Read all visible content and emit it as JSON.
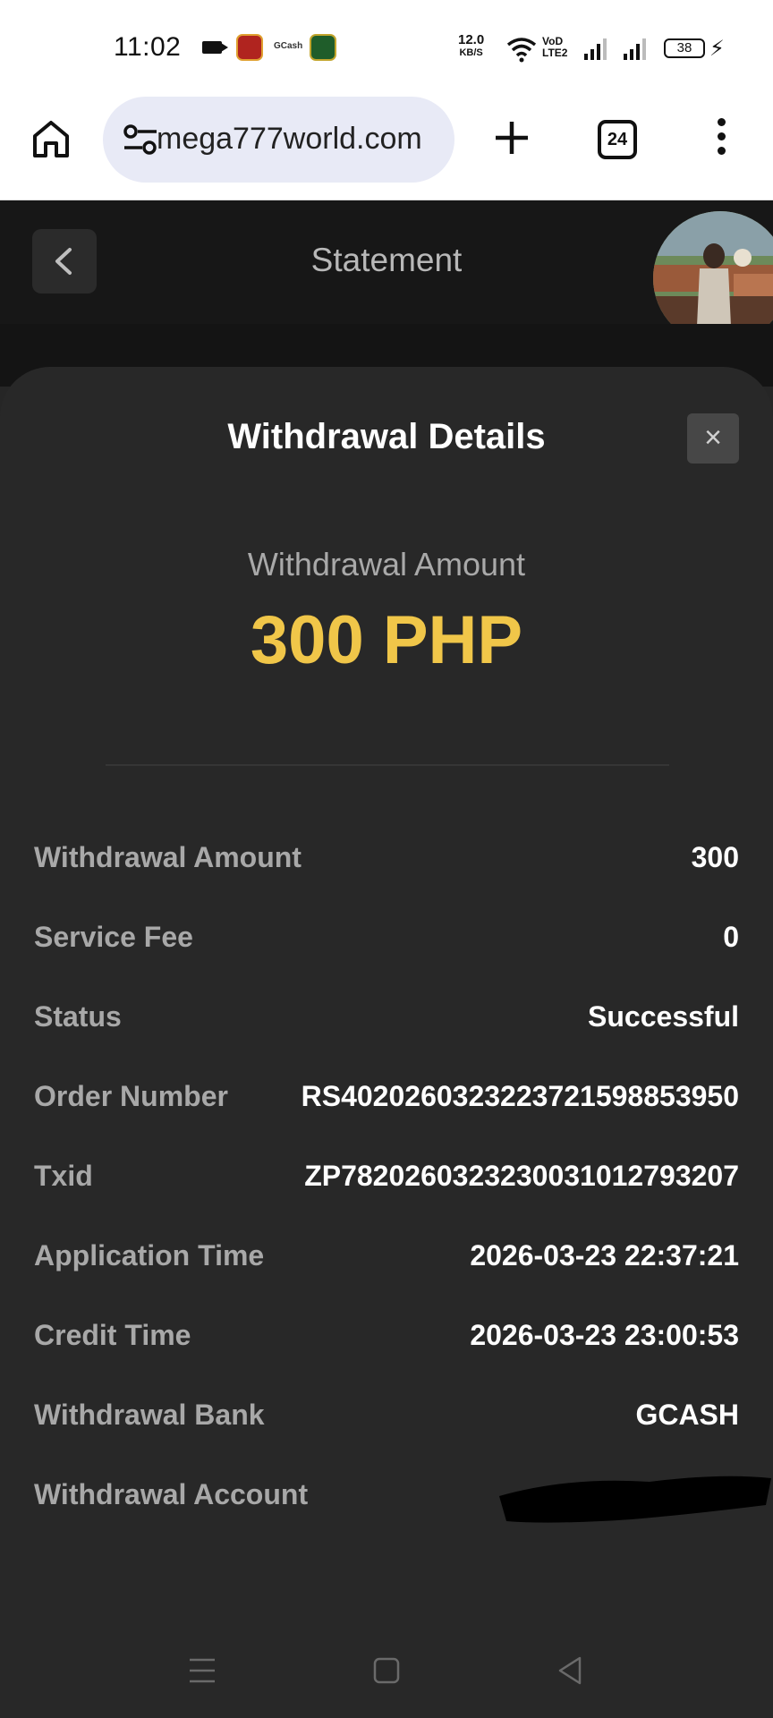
{
  "status_bar": {
    "time": "11:02",
    "gcash_label": "GCash",
    "net_speed_value": "12.0",
    "net_speed_unit": "KB/S",
    "volte_line1": "VoD",
    "volte_line2": "LTE2",
    "battery": "38"
  },
  "browser": {
    "url": "mega777world.com",
    "tab_count": "24"
  },
  "header": {
    "title": "Statement"
  },
  "sheet": {
    "title": "Withdrawal Details",
    "close": "×",
    "amount_label": "Withdrawal Amount",
    "amount_value": "300 PHP",
    "rows": [
      {
        "label": "Withdrawal Amount",
        "value": "300"
      },
      {
        "label": "Service Fee",
        "value": "0"
      },
      {
        "label": "Status",
        "value": "Successful"
      },
      {
        "label": "Order Number",
        "value": "RS4020260323223721598853950"
      },
      {
        "label": "Txid",
        "value": "ZP7820260323230031012793207"
      },
      {
        "label": "Application Time",
        "value": "2026-03-23 22:37:21"
      },
      {
        "label": "Credit Time",
        "value": "2026-03-23 23:00:53"
      },
      {
        "label": "Withdrawal Bank",
        "value": "GCASH"
      },
      {
        "label": "Withdrawal Account",
        "value": ""
      }
    ]
  },
  "colors": {
    "accent_amount": "#f0c649",
    "sheet_bg": "#282828"
  }
}
